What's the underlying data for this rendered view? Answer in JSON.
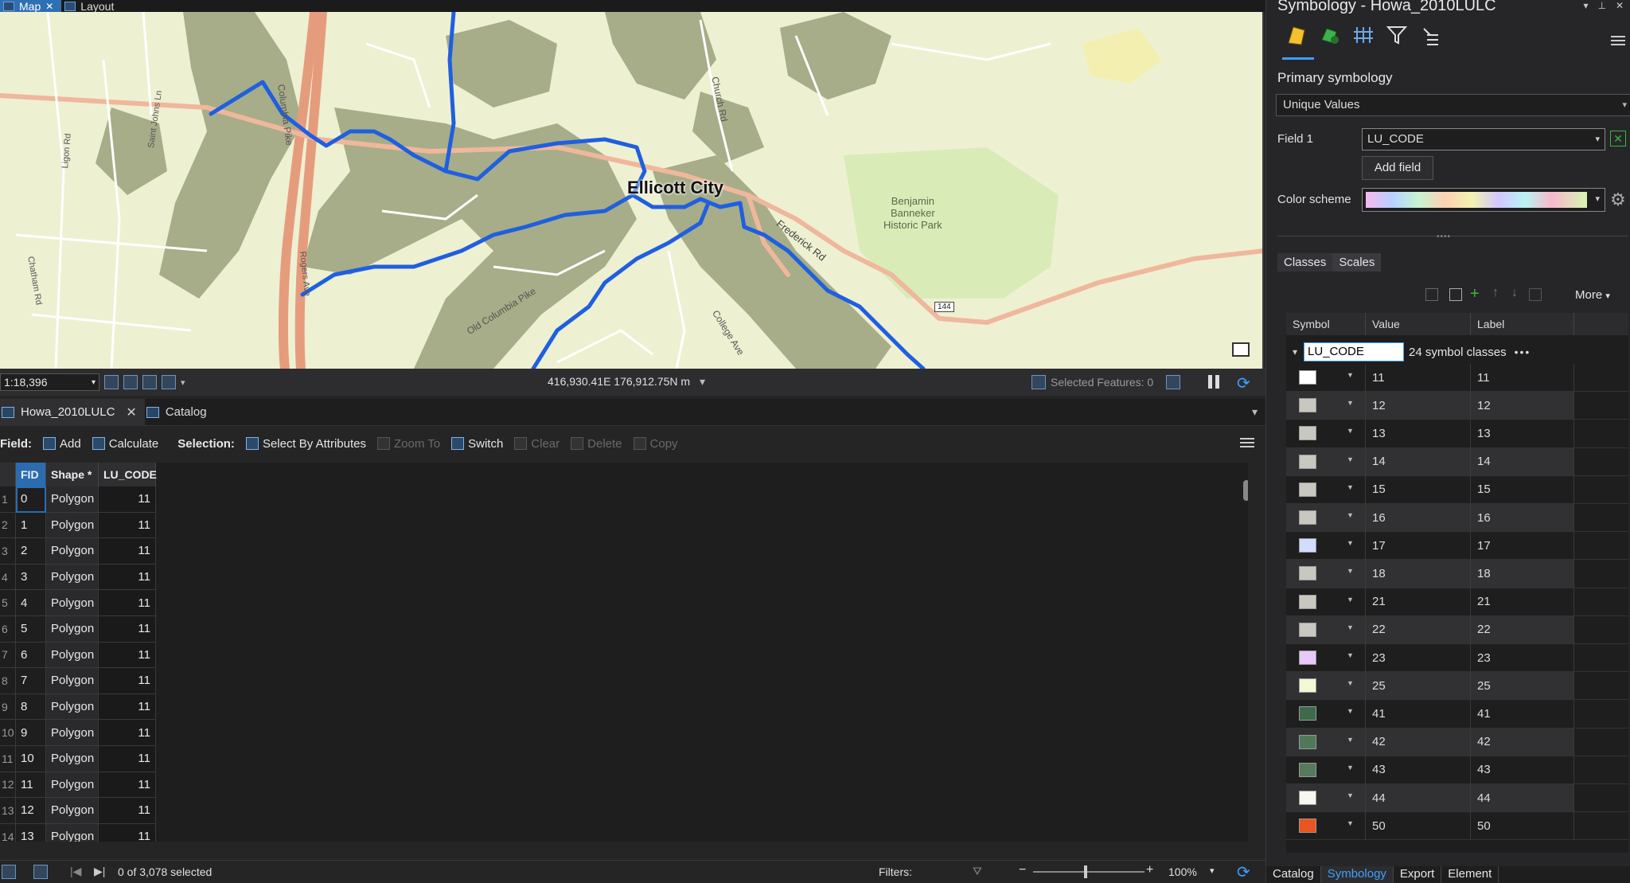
{
  "doc_tabs": [
    {
      "label": "Map",
      "active": true,
      "close": "✕"
    },
    {
      "label": "Layout",
      "active": false
    }
  ],
  "map": {
    "labels": {
      "city": "Ellicott City",
      "park": [
        "Benjamin",
        "Banneker",
        "Historic Park"
      ],
      "roads": [
        "Columbia Pike",
        "Church Rd",
        "Frederick Rd",
        "Old Columbia Pike",
        "College Ave",
        "Saint Johns Ln",
        "Chatham Rd",
        "Ligon Rd",
        "Rogers Ave"
      ],
      "shield": "144"
    },
    "colors": {
      "base": "#eef0d2",
      "forest": "#a6ad88",
      "highway": "#e59c7d",
      "stream": "#1f5fe0",
      "park": "#d9ecb8"
    }
  },
  "map_status": {
    "scale": "1:18,396",
    "coordinates": "416,930.41E 176,912.75N m",
    "selected_features": "Selected Features: 0"
  },
  "table_tabs": [
    {
      "label": "Howa_2010LULC",
      "active": true
    },
    {
      "label": "Catalog",
      "active": false
    }
  ],
  "toolbar": {
    "field_label": "Field:",
    "add": "Add",
    "calculate": "Calculate",
    "selection_label": "Selection:",
    "select_by_attributes": "Select By Attributes",
    "zoom_to": "Zoom To",
    "switch": "Switch",
    "clear": "Clear",
    "delete": "Delete",
    "copy": "Copy"
  },
  "attr_table": {
    "columns": [
      "FID",
      "Shape *",
      "LU_CODE"
    ],
    "rows": [
      {
        "n": "1",
        "fid": "0",
        "shape": "Polygon",
        "code": "11"
      },
      {
        "n": "2",
        "fid": "1",
        "shape": "Polygon",
        "code": "11"
      },
      {
        "n": "3",
        "fid": "2",
        "shape": "Polygon",
        "code": "11"
      },
      {
        "n": "4",
        "fid": "3",
        "shape": "Polygon",
        "code": "11"
      },
      {
        "n": "5",
        "fid": "4",
        "shape": "Polygon",
        "code": "11"
      },
      {
        "n": "6",
        "fid": "5",
        "shape": "Polygon",
        "code": "11"
      },
      {
        "n": "7",
        "fid": "6",
        "shape": "Polygon",
        "code": "11"
      },
      {
        "n": "8",
        "fid": "7",
        "shape": "Polygon",
        "code": "11"
      },
      {
        "n": "9",
        "fid": "8",
        "shape": "Polygon",
        "code": "11"
      },
      {
        "n": "10",
        "fid": "9",
        "shape": "Polygon",
        "code": "11"
      },
      {
        "n": "11",
        "fid": "10",
        "shape": "Polygon",
        "code": "11"
      },
      {
        "n": "12",
        "fid": "11",
        "shape": "Polygon",
        "code": "11"
      },
      {
        "n": "13",
        "fid": "12",
        "shape": "Polygon",
        "code": "11"
      },
      {
        "n": "14",
        "fid": "13",
        "shape": "Polygon",
        "code": "11"
      }
    ]
  },
  "bottom_bar": {
    "selected": "0 of 3,078 selected",
    "filters": "Filters:",
    "zoom": "100%"
  },
  "symbology": {
    "title": "Symbology - Howa_2010LULC",
    "primary_label": "Primary symbology",
    "primary_value": "Unique Values",
    "field1_label": "Field 1",
    "field1_value": "LU_CODE",
    "add_field": "Add field",
    "color_scheme_label": "Color scheme",
    "tabs": [
      "Classes",
      "Scales"
    ],
    "more": "More",
    "columns": [
      "Symbol",
      "Value",
      "Label"
    ],
    "group_field": "LU_CODE",
    "group_count": "24 symbol classes",
    "group_dots": "•••",
    "classes": [
      {
        "value": "11",
        "label": "11",
        "color": "#ffffff"
      },
      {
        "value": "12",
        "label": "12",
        "color": "#c8c8c0"
      },
      {
        "value": "13",
        "label": "13",
        "color": "#c8c8c0"
      },
      {
        "value": "14",
        "label": "14",
        "color": "#c8c8c0"
      },
      {
        "value": "15",
        "label": "15",
        "color": "#c8c8c0"
      },
      {
        "value": "16",
        "label": "16",
        "color": "#c8c8c0"
      },
      {
        "value": "17",
        "label": "17",
        "color": "#d2dcff"
      },
      {
        "value": "18",
        "label": "18",
        "color": "#c8c8c0"
      },
      {
        "value": "21",
        "label": "21",
        "color": "#c8c8c0"
      },
      {
        "value": "22",
        "label": "22",
        "color": "#c8c8c0"
      },
      {
        "value": "23",
        "label": "23",
        "color": "#e8c8f8"
      },
      {
        "value": "25",
        "label": "25",
        "color": "#f2f8d6"
      },
      {
        "value": "41",
        "label": "41",
        "color": "#3e6a4a"
      },
      {
        "value": "42",
        "label": "42",
        "color": "#4f7a58"
      },
      {
        "value": "43",
        "label": "43",
        "color": "#567a5c"
      },
      {
        "value": "44",
        "label": "44",
        "color": "#f4f8ee"
      },
      {
        "value": "50",
        "label": "50",
        "color": "#e8551e"
      }
    ],
    "bottom_tabs": [
      "Catalog",
      "Symbology",
      "Export",
      "Element"
    ]
  }
}
